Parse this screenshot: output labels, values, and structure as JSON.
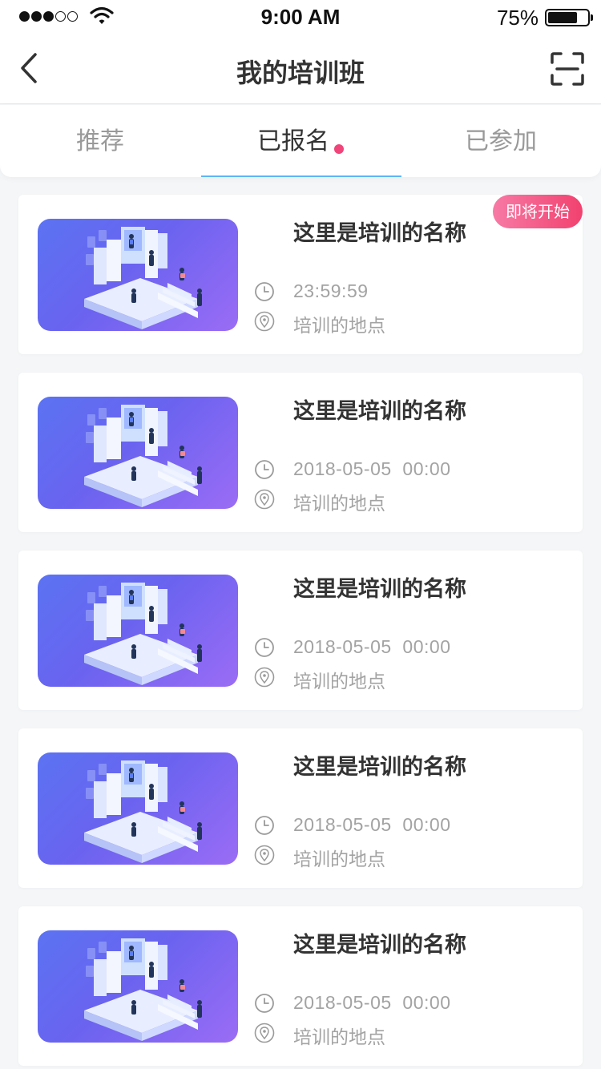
{
  "status_bar": {
    "time": "9:00 AM",
    "battery": "75%",
    "battery_level": 0.75,
    "signal_strength": "3 of 5"
  },
  "nav": {
    "title": "我的培训班",
    "back_icon": "chevron-left-icon",
    "scan_icon": "scan-icon"
  },
  "tabs": [
    {
      "label": "推荐",
      "active": false,
      "dot": false
    },
    {
      "label": "已报名",
      "active": true,
      "dot": true
    },
    {
      "label": "已参加",
      "active": false,
      "dot": false
    }
  ],
  "colors": {
    "accent_underline": "#5eb6f5",
    "badge_start": "#f77aa5",
    "badge_end": "#f2416f",
    "thumb_start": "#5b73f2",
    "thumb_end": "#9b6cf5"
  },
  "cards": [
    {
      "title": "这里是培训的名称",
      "time": "23:59:59",
      "location": "培训的地点",
      "badge": "即将开始"
    },
    {
      "title": "这里是培训的名称",
      "time": "2018-05-05  00:00",
      "location": "培训的地点",
      "badge": ""
    },
    {
      "title": "这里是培训的名称",
      "time": "2018-05-05  00:00",
      "location": "培训的地点",
      "badge": ""
    },
    {
      "title": "这里是培训的名称",
      "time": "2018-05-05  00:00",
      "location": "培训的地点",
      "badge": ""
    },
    {
      "title": "这里是培训的名称",
      "time": "2018-05-05  00:00",
      "location": "培训的地点",
      "badge": ""
    }
  ]
}
